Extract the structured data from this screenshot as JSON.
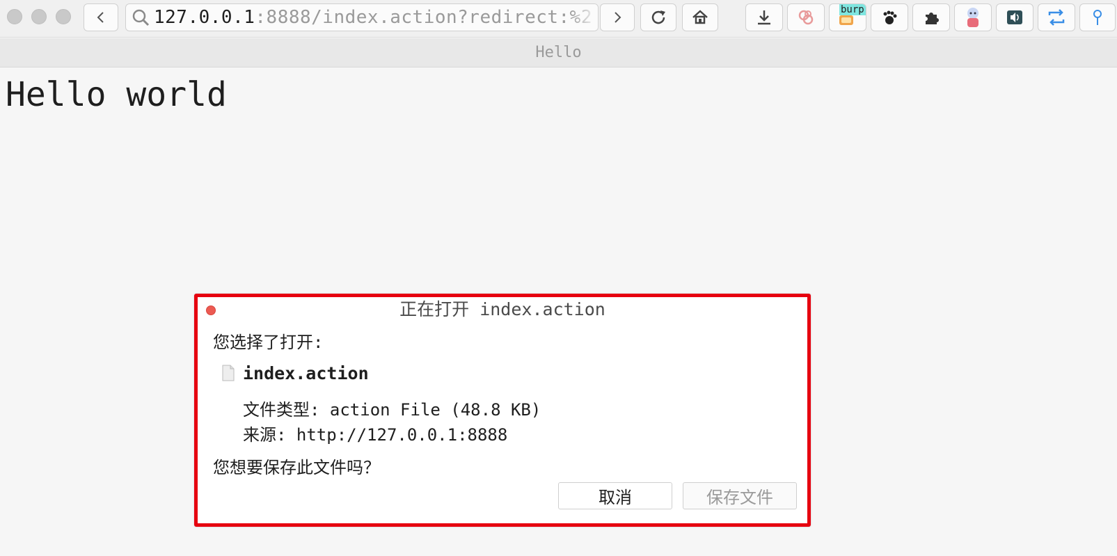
{
  "browser": {
    "url_host": "127.0.0.1",
    "url_rest": ":8888/index.action?redirect:%2",
    "tab_title": "Hello",
    "icons": {
      "back": "chevron-left-icon",
      "forward": "chevron-right-icon",
      "reload": "reload-icon",
      "home": "home-icon",
      "download": "download-icon",
      "ext1": "rings-extension-icon",
      "burp": "burp-extension-icon",
      "gnome": "footprint-extension-icon",
      "puzzle": "puzzle-extension-icon",
      "anime": "avatar-extension-icon",
      "sound": "speaker-extension-icon",
      "sync": "sync-extension-icon",
      "pin": "pin-extension-icon"
    },
    "burp_label": "burp"
  },
  "page": {
    "heading": "Hello world"
  },
  "dialog": {
    "title": "正在打开 index.action",
    "chosen_label": "您选择了打开:",
    "filename": "index.action",
    "filetype_line": "文件类型: action File (48.8 KB)",
    "source_line": "来源: http://127.0.0.1:8888",
    "question": "您想要保存此文件吗？",
    "cancel_label": "取消",
    "save_label": "保存文件",
    "accent_color": "#e6000f"
  }
}
